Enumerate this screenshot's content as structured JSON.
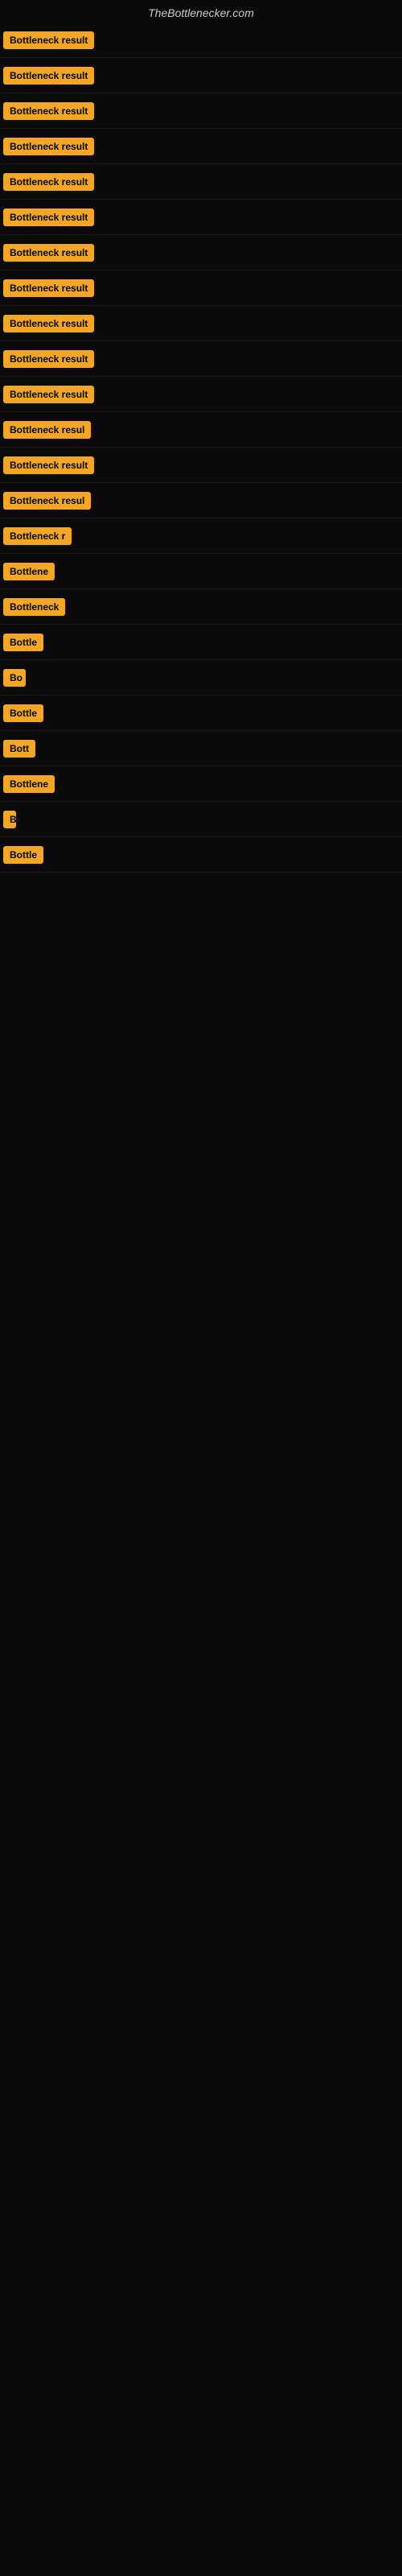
{
  "site": {
    "title": "TheBottlenecker.com"
  },
  "rows": [
    {
      "id": 1,
      "label": "Bottleneck result",
      "width": 130
    },
    {
      "id": 2,
      "label": "Bottleneck result",
      "width": 130
    },
    {
      "id": 3,
      "label": "Bottleneck result",
      "width": 130
    },
    {
      "id": 4,
      "label": "Bottleneck result",
      "width": 130
    },
    {
      "id": 5,
      "label": "Bottleneck result",
      "width": 130
    },
    {
      "id": 6,
      "label": "Bottleneck result",
      "width": 130
    },
    {
      "id": 7,
      "label": "Bottleneck result",
      "width": 130
    },
    {
      "id": 8,
      "label": "Bottleneck result",
      "width": 130
    },
    {
      "id": 9,
      "label": "Bottleneck result",
      "width": 130
    },
    {
      "id": 10,
      "label": "Bottleneck result",
      "width": 130
    },
    {
      "id": 11,
      "label": "Bottleneck result",
      "width": 130
    },
    {
      "id": 12,
      "label": "Bottleneck resul",
      "width": 122
    },
    {
      "id": 13,
      "label": "Bottleneck result",
      "width": 130
    },
    {
      "id": 14,
      "label": "Bottleneck resul",
      "width": 122
    },
    {
      "id": 15,
      "label": "Bottleneck r",
      "width": 88
    },
    {
      "id": 16,
      "label": "Bottlene",
      "width": 72
    },
    {
      "id": 17,
      "label": "Bottleneck",
      "width": 80
    },
    {
      "id": 18,
      "label": "Bottle",
      "width": 60
    },
    {
      "id": 19,
      "label": "Bo",
      "width": 28
    },
    {
      "id": 20,
      "label": "Bottle",
      "width": 60
    },
    {
      "id": 21,
      "label": "Bott",
      "width": 40
    },
    {
      "id": 22,
      "label": "Bottlene",
      "width": 72
    },
    {
      "id": 23,
      "label": "B",
      "width": 16
    },
    {
      "id": 24,
      "label": "Bottle",
      "width": 60
    }
  ]
}
